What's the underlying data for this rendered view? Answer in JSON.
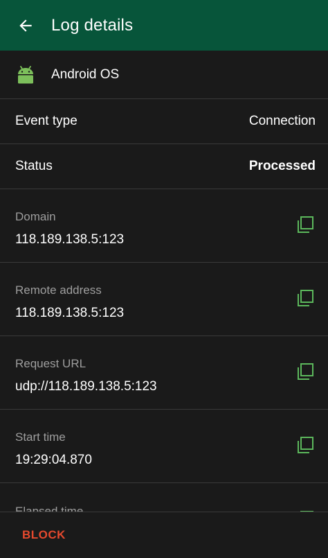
{
  "appbar": {
    "title": "Log details",
    "back_icon": "arrow-left-icon",
    "background": "#07553a"
  },
  "app": {
    "name": "Android OS",
    "icon": "android-icon",
    "icon_color": "#7cbf5b"
  },
  "event_type": {
    "label": "Event type",
    "value": "Connection"
  },
  "status": {
    "label": "Status",
    "value": "Processed"
  },
  "details": [
    {
      "label": "Domain",
      "value": "118.189.138.5:123"
    },
    {
      "label": "Remote address",
      "value": "118.189.138.5:123"
    },
    {
      "label": "Request URL",
      "value": "udp://118.189.138.5:123"
    },
    {
      "label": "Start time",
      "value": "19:29:04.870"
    },
    {
      "label": "Elapsed time"
    }
  ],
  "copy_icon": {
    "name": "copy-icon",
    "color": "#5cb85c"
  },
  "actions": {
    "block_label": "BLOCK",
    "block_color": "#e5492e"
  }
}
